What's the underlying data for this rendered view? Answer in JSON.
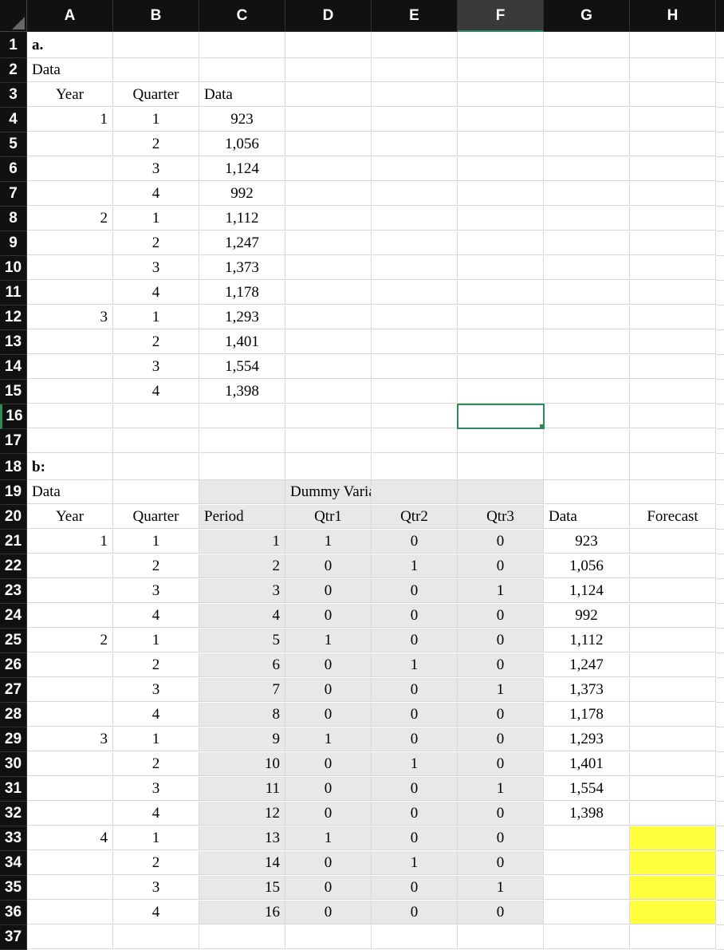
{
  "columns": [
    "A",
    "B",
    "C",
    "D",
    "E",
    "F",
    "G",
    "H"
  ],
  "selected_column": "F",
  "selected_row": 16,
  "row_count": 37,
  "section_a": {
    "title_row": 1,
    "title": "a.",
    "data_label_row": 2,
    "data_label": "Data",
    "header_row": 3,
    "headers": {
      "year": "Year",
      "quarter": "Quarter",
      "data": "Data"
    },
    "rows": [
      {
        "r": 4,
        "year": "1",
        "quarter": "1",
        "data": "923"
      },
      {
        "r": 5,
        "year": "",
        "quarter": "2",
        "data": "1,056"
      },
      {
        "r": 6,
        "year": "",
        "quarter": "3",
        "data": "1,124"
      },
      {
        "r": 7,
        "year": "",
        "quarter": "4",
        "data": "992"
      },
      {
        "r": 8,
        "year": "2",
        "quarter": "1",
        "data": "1,112"
      },
      {
        "r": 9,
        "year": "",
        "quarter": "2",
        "data": "1,247"
      },
      {
        "r": 10,
        "year": "",
        "quarter": "3",
        "data": "1,373"
      },
      {
        "r": 11,
        "year": "",
        "quarter": "4",
        "data": "1,178"
      },
      {
        "r": 12,
        "year": "3",
        "quarter": "1",
        "data": "1,293"
      },
      {
        "r": 13,
        "year": "",
        "quarter": "2",
        "data": "1,401"
      },
      {
        "r": 14,
        "year": "",
        "quarter": "3",
        "data": "1,554"
      },
      {
        "r": 15,
        "year": "",
        "quarter": "4",
        "data": "1,398"
      }
    ]
  },
  "section_b": {
    "title_row": 18,
    "title": "b:",
    "data_label_row": 19,
    "data_label": "Data",
    "dummy_label_row": 19,
    "dummy_label": "Dummy Variables",
    "header_row": 20,
    "headers": {
      "year": "Year",
      "quarter": "Quarter",
      "period": "Period",
      "qtr1": "Qtr1",
      "qtr2": "Qtr2",
      "qtr3": "Qtr3",
      "data": "Data",
      "forecast": "Forecast"
    },
    "rows": [
      {
        "r": 21,
        "year": "1",
        "quarter": "1",
        "period": "1",
        "q1": "1",
        "q2": "0",
        "q3": "0",
        "data": "923",
        "yellow": false
      },
      {
        "r": 22,
        "year": "",
        "quarter": "2",
        "period": "2",
        "q1": "0",
        "q2": "1",
        "q3": "0",
        "data": "1,056",
        "yellow": false
      },
      {
        "r": 23,
        "year": "",
        "quarter": "3",
        "period": "3",
        "q1": "0",
        "q2": "0",
        "q3": "1",
        "data": "1,124",
        "yellow": false
      },
      {
        "r": 24,
        "year": "",
        "quarter": "4",
        "period": "4",
        "q1": "0",
        "q2": "0",
        "q3": "0",
        "data": "992",
        "yellow": false
      },
      {
        "r": 25,
        "year": "2",
        "quarter": "1",
        "period": "5",
        "q1": "1",
        "q2": "0",
        "q3": "0",
        "data": "1,112",
        "yellow": false
      },
      {
        "r": 26,
        "year": "",
        "quarter": "2",
        "period": "6",
        "q1": "0",
        "q2": "1",
        "q3": "0",
        "data": "1,247",
        "yellow": false
      },
      {
        "r": 27,
        "year": "",
        "quarter": "3",
        "period": "7",
        "q1": "0",
        "q2": "0",
        "q3": "1",
        "data": "1,373",
        "yellow": false
      },
      {
        "r": 28,
        "year": "",
        "quarter": "4",
        "period": "8",
        "q1": "0",
        "q2": "0",
        "q3": "0",
        "data": "1,178",
        "yellow": false
      },
      {
        "r": 29,
        "year": "3",
        "quarter": "1",
        "period": "9",
        "q1": "1",
        "q2": "0",
        "q3": "0",
        "data": "1,293",
        "yellow": false
      },
      {
        "r": 30,
        "year": "",
        "quarter": "2",
        "period": "10",
        "q1": "0",
        "q2": "1",
        "q3": "0",
        "data": "1,401",
        "yellow": false
      },
      {
        "r": 31,
        "year": "",
        "quarter": "3",
        "period": "11",
        "q1": "0",
        "q2": "0",
        "q3": "1",
        "data": "1,554",
        "yellow": false
      },
      {
        "r": 32,
        "year": "",
        "quarter": "4",
        "period": "12",
        "q1": "0",
        "q2": "0",
        "q3": "0",
        "data": "1,398",
        "yellow": false
      },
      {
        "r": 33,
        "year": "4",
        "quarter": "1",
        "period": "13",
        "q1": "1",
        "q2": "0",
        "q3": "0",
        "data": "",
        "yellow": true
      },
      {
        "r": 34,
        "year": "",
        "quarter": "2",
        "period": "14",
        "q1": "0",
        "q2": "1",
        "q3": "0",
        "data": "",
        "yellow": true
      },
      {
        "r": 35,
        "year": "",
        "quarter": "3",
        "period": "15",
        "q1": "0",
        "q2": "0",
        "q3": "1",
        "data": "",
        "yellow": true
      },
      {
        "r": 36,
        "year": "",
        "quarter": "4",
        "period": "16",
        "q1": "0",
        "q2": "0",
        "q3": "0",
        "data": "",
        "yellow": true
      }
    ]
  }
}
